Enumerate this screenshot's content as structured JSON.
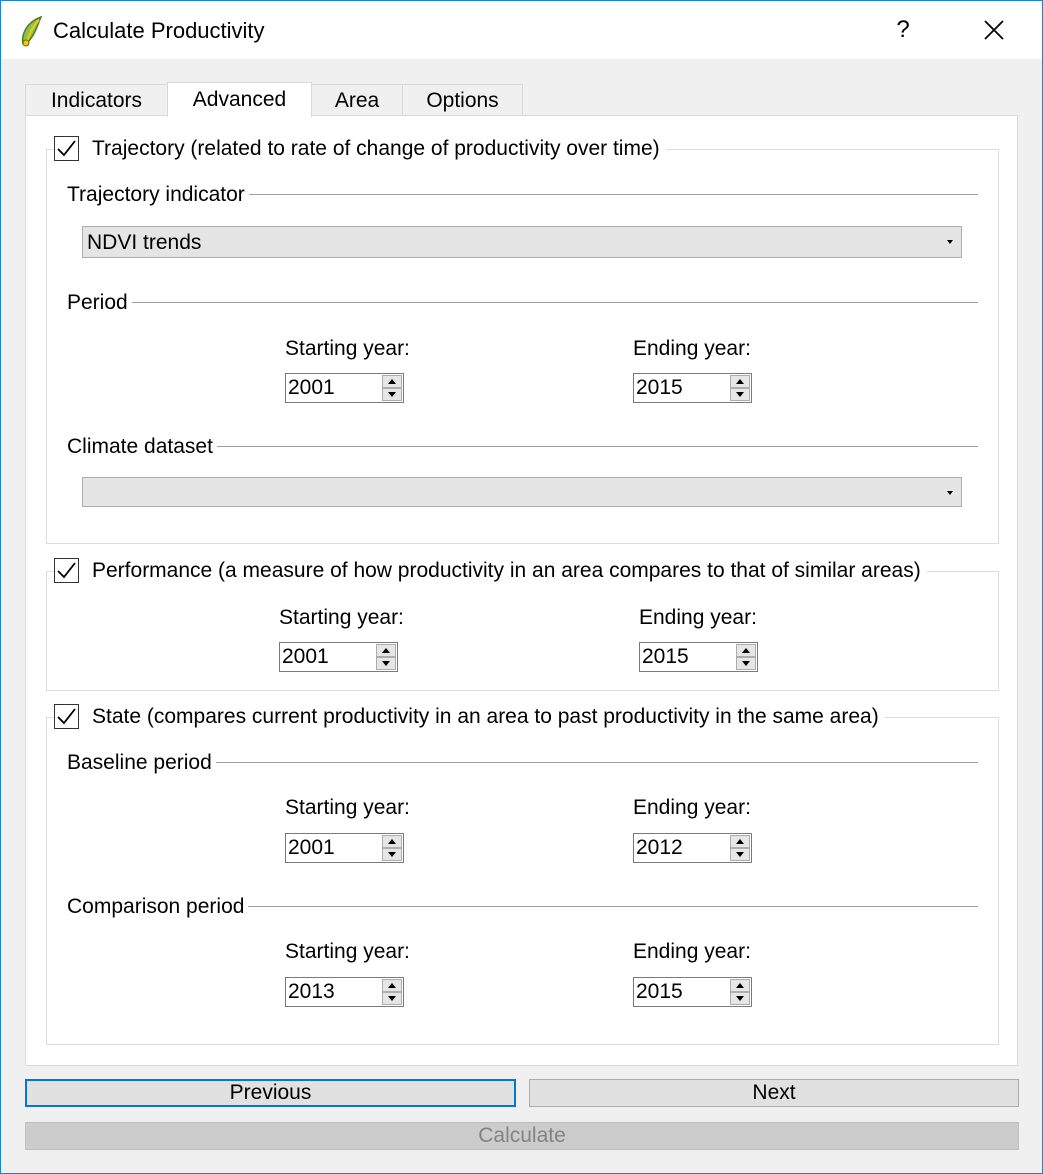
{
  "window": {
    "title": "Calculate Productivity",
    "help_label": "?",
    "accent_color": "#1883d7"
  },
  "tabs": [
    {
      "label": "Indicators",
      "active": false
    },
    {
      "label": "Advanced",
      "active": true
    },
    {
      "label": "Area",
      "active": false
    },
    {
      "label": "Options",
      "active": false
    }
  ],
  "trajectory": {
    "title": "Trajectory (related to rate of change of  productivity over time)",
    "checked": true,
    "indicator_label": "Trajectory indicator",
    "indicator_value": "NDVI trends",
    "period_label": "Period",
    "start_label": "Starting year:",
    "start_value": "2001",
    "end_label": "Ending year:",
    "end_value": "2015",
    "climate_label": "Climate dataset",
    "climate_value": ""
  },
  "performance": {
    "title": "Performance (a measure of how productivity in an area compares to that of similar areas)",
    "checked": true,
    "start_label": "Starting year:",
    "start_value": "2001",
    "end_label": "Ending year:",
    "end_value": "2015"
  },
  "state": {
    "title": "State (compares current productivity in an area to past productivity in the same area)",
    "checked": true,
    "baseline_label": "Baseline period",
    "baseline_start_label": "Starting year:",
    "baseline_start_value": "2001",
    "baseline_end_label": "Ending year:",
    "baseline_end_value": "2012",
    "comparison_label": "Comparison period",
    "comparison_start_label": "Starting year:",
    "comparison_start_value": "2013",
    "comparison_end_label": "Ending year:",
    "comparison_end_value": "2015"
  },
  "buttons": {
    "previous": "Previous",
    "next": "Next",
    "calculate": "Calculate"
  }
}
